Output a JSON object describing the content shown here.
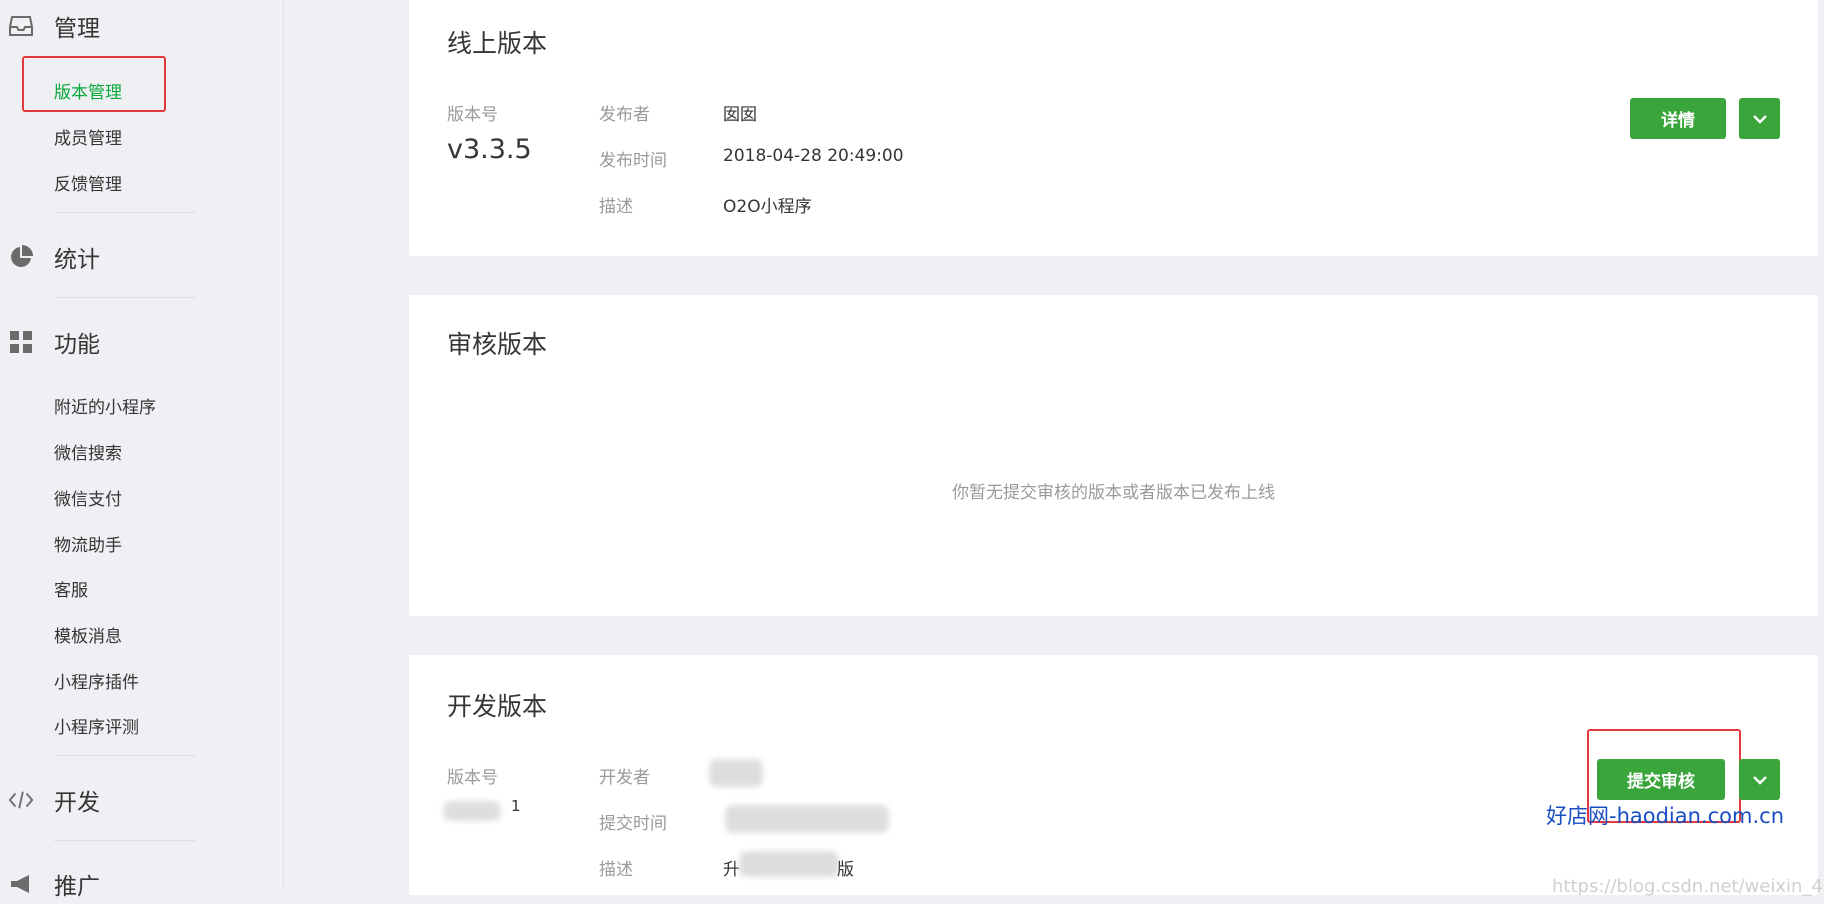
{
  "sidebar": {
    "manage": {
      "label": "管理",
      "items": [
        {
          "label": "版本管理"
        },
        {
          "label": "成员管理"
        },
        {
          "label": "反馈管理"
        }
      ]
    },
    "stats": {
      "label": "统计"
    },
    "features": {
      "label": "功能",
      "items": [
        {
          "label": "附近的小程序"
        },
        {
          "label": "微信搜索"
        },
        {
          "label": "微信支付"
        },
        {
          "label": "物流助手"
        },
        {
          "label": "客服"
        },
        {
          "label": "模板消息"
        },
        {
          "label": "小程序插件"
        },
        {
          "label": "小程序评测"
        }
      ]
    },
    "develop": {
      "label": "开发"
    },
    "promote": {
      "label": "推广"
    }
  },
  "online": {
    "title": "线上版本",
    "version_label": "版本号",
    "version": "v3.3.5",
    "publisher_label": "发布者",
    "publisher": "囡囡",
    "time_label": "发布时间",
    "time": "2018-04-28 20:49:00",
    "desc_label": "描述",
    "desc": "O2O小程序",
    "detail_button": "详情"
  },
  "review": {
    "title": "审核版本",
    "empty_text": "你暂无提交审核的版本或者版本已发布上线"
  },
  "dev": {
    "title": "开发版本",
    "version_label": "版本号",
    "version_visible": "1",
    "developer_label": "开发者",
    "time_label": "提交时间",
    "desc_label": "描述",
    "desc_prefix": "升",
    "desc_suffix": "版",
    "submit_button": "提交审核"
  },
  "watermarks": {
    "site": "好店网-haodian.com.cn",
    "blog": "https://blog.csdn.net/weixin_4"
  },
  "colors": {
    "accent": "#3aa53b",
    "active_nav": "#07a93b",
    "highlight": "#e4393c"
  }
}
